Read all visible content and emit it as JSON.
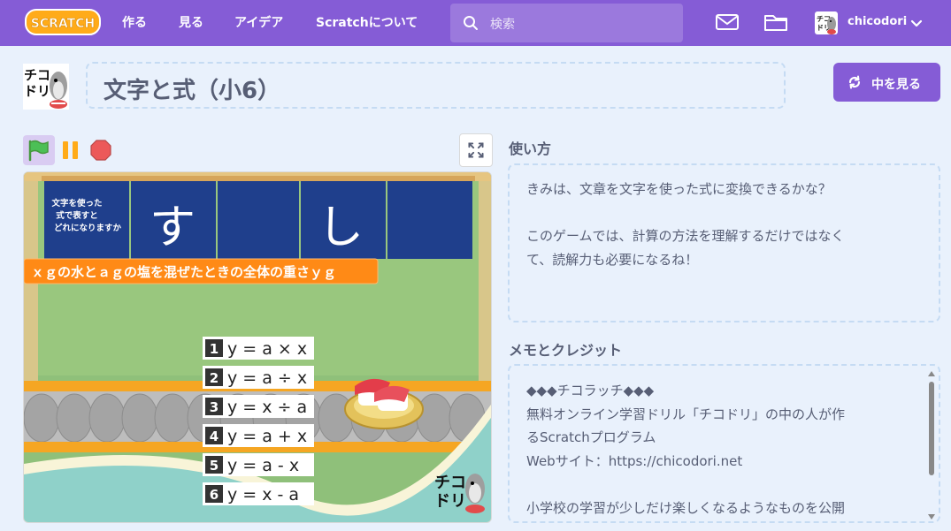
{
  "nav": {
    "logo": "SCRATCH",
    "create": "作る",
    "explore": "見る",
    "ideas": "アイデア",
    "about": "Scratchについて",
    "search_placeholder": "検索",
    "username": "chicodori"
  },
  "project": {
    "title": "文字と式（小6）",
    "see_inside": "中を見る"
  },
  "stage": {
    "noren_text_line1": "文字を使った",
    "noren_text_line2": "式で表すと",
    "noren_text_line3": "どれになりますか",
    "noren_char1": "す",
    "noren_char2": "し",
    "question": "ｘｇの水とａｇの塩を混ぜたときの全体の重さｙｇ",
    "options": [
      {
        "num": "1",
        "eq": "y = a × x"
      },
      {
        "num": "2",
        "eq": "y = a ÷ x"
      },
      {
        "num": "3",
        "eq": "y = x ÷ a"
      },
      {
        "num": "4",
        "eq": "y = a + x"
      },
      {
        "num": "5",
        "eq": "y = a - x"
      },
      {
        "num": "6",
        "eq": "y = x - a"
      }
    ],
    "watermark_line1": "チコ",
    "watermark_line2": "ドリ"
  },
  "instructions": {
    "label": "使い方",
    "text": "きみは、文章を文字を使った式に変換できるかな？\n\nこのゲームでは、計算の方法を理解するだけではなく\nて、読解力も必要になるね！"
  },
  "credits": {
    "label": "メモとクレジット",
    "text": "◆◆◆チコラッチ◆◆◆\n無料オンライン学習ドリル「チコドリ」の中の人が作\nるScratchプログラム\nWebサイト：https://chicodori.net\n\n小学校の学習が少しだけ楽しくなるようなものを公開"
  },
  "colors": {
    "brand": "#855cd6",
    "flag": "#4cbf56",
    "pause": "#ffab19",
    "stop": "#ec5959",
    "question_bg": "#ff8a16"
  },
  "icons": [
    "search-icon",
    "message-icon",
    "folder-icon",
    "chevron-down-icon",
    "remix-icon",
    "green-flag-icon",
    "pause-icon",
    "stop-icon",
    "fullscreen-icon"
  ]
}
